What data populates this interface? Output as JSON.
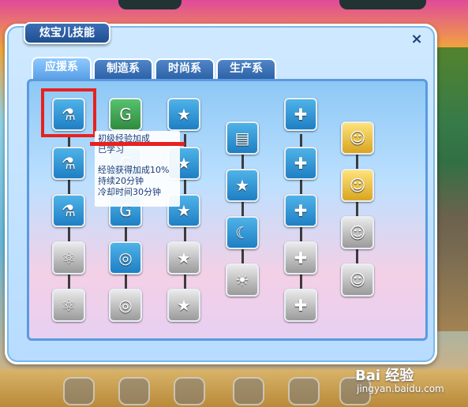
{
  "window": {
    "title": "炫宝儿技能",
    "close": "×"
  },
  "tabs": [
    {
      "label": "应援系",
      "active": true
    },
    {
      "label": "制造系",
      "active": false
    },
    {
      "label": "时尚系",
      "active": false
    },
    {
      "label": "生产系",
      "active": false
    }
  ],
  "tooltip": {
    "name": "初级经验加成",
    "status": "已学习",
    "desc1": "经验获得加成10%",
    "desc2": "持续20分钟",
    "desc3": "冷却时间30分钟"
  },
  "skills": {
    "col1": [
      "test-tube-icon",
      "test-tubes-icon",
      "flasks-icon",
      "molecule-icon",
      "molecule-icon"
    ],
    "col2": [
      "g-coin-icon",
      "g-coin-icon",
      "g-coin-icon",
      "coin-stack-icon",
      "coin-stack-icon"
    ],
    "col3": [
      "star-badge-icon",
      "star-badge-icon",
      "star-badge-icon",
      "star-badge-icon",
      "star-badge-icon"
    ],
    "col4": [
      "film-icon",
      "film-star-icon",
      "film-moon-icon",
      "film-sun-icon"
    ],
    "col5": [
      "medkit-icon",
      "medkit-icon",
      "medkit-icon",
      "medkit-icon",
      "medkit-icon"
    ],
    "col6": [
      "exp-person-icon",
      "exp-person-icon",
      "exp-person-icon",
      "exp-person-icon"
    ]
  },
  "watermark": {
    "brand": "Bai 经验",
    "url": "jingyan.baidu.com"
  },
  "colors": {
    "highlight": "#e8211f",
    "tab": "#2e62a8",
    "panel_border": "#5a9ae0"
  }
}
